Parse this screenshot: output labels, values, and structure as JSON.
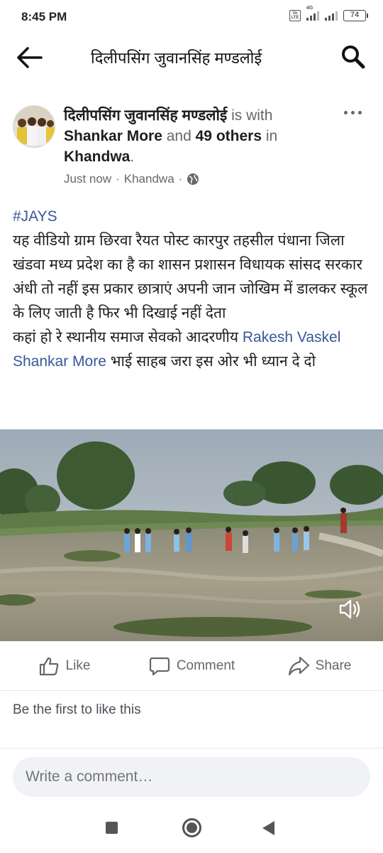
{
  "status_bar": {
    "time": "8:45 PM",
    "network": "4G",
    "volte": "Vo LTE",
    "battery": "74"
  },
  "header": {
    "title": "दिलीपसिंग जुवानसिंह मण्डलोई",
    "back_icon": "arrow-left-icon",
    "search_icon": "search-icon"
  },
  "post": {
    "author": "दिलीपसिंग जुवानसिंह मण्डलोई",
    "is_with": "is with",
    "tagged": "Shankar More",
    "and": "and",
    "others": "49 others",
    "in": "in",
    "location": "Khandwa",
    "period": ".",
    "time": "Just now",
    "sep": "·",
    "place": "Khandwa",
    "privacy_icon": "globe-icon",
    "hashtag": "#JAYS",
    "body": "यह वीडियो ग्राम छिरवा रैयत पोस्ट कारपुर तहसील पंधाना जिला खंडवा मध्य प्रदेश का है का शासन प्रशासन विधायक सांसद सरकार अंधी तो नहीं इस प्रकार छात्राएं अपनी जान जोखिम में डालकर स्कूल के लिए जाती है फिर भी दिखाई नहीं देता",
    "line2_prefix": "कहां हो रे स्थानीय समाज सेवको आदरणीय",
    "mention1": "Rakesh Vaskel",
    "mention2": "Shankar More",
    "line2_suffix": "भाई साहब जरा इस ओर भी ध्यान दे दो"
  },
  "actions": {
    "like": "Like",
    "comment": "Comment",
    "share": "Share"
  },
  "reactions": {
    "first_like": "Be the first to like this"
  },
  "comment_box": {
    "placeholder": "Write a comment…"
  },
  "colors": {
    "link": "#385898",
    "secondary_text": "#65676b",
    "input_bg": "#f0f2f5"
  }
}
